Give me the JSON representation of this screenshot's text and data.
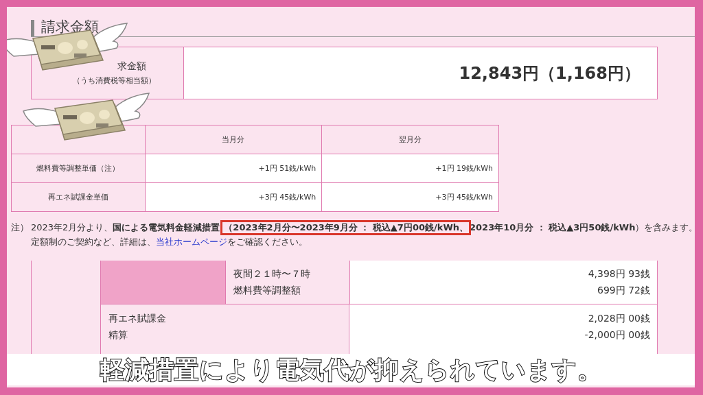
{
  "section_title": "請求金額",
  "bill": {
    "label": "求金額",
    "sublabel": "（うち消費税等相当額）",
    "amount": "12,843円（1,168円）"
  },
  "rates": {
    "columns": [
      "当月分",
      "翌月分"
    ],
    "rows": [
      {
        "label": "燃料費等調整単価（注）",
        "values": [
          "+1円 51銭/kWh",
          "+1円 19銭/kWh"
        ]
      },
      {
        "label": "再エネ賦課金単価",
        "values": [
          "+3円 45銭/kWh",
          "+3円 45銭/kWh"
        ]
      }
    ]
  },
  "note": {
    "mark": "注）",
    "segments": [
      {
        "text": "2023年2月分より、**国による電気料金軽減措置**",
        "highlighted": false
      },
      {
        "text": "**（2023年2月分〜2023年9月分 ： 税込▲7円00銭/kWh、**",
        "highlighted": true
      },
      {
        "text": "**2023年10月分 ： 税込▲3円50銭/kWh**）を含みます。",
        "highlighted": false
      }
    ],
    "line2_before": "定額制のご契約など、詳細は、",
    "link": "当社ホームページ",
    "line2_after": "をご確認ください。"
  },
  "charges": [
    {
      "kind": "shaded",
      "labels": [
        "夜間２１時〜７時",
        "燃料費等調整額"
      ],
      "values": [
        "4,398円 93銭",
        "699円 72銭"
      ]
    },
    {
      "kind": "plain",
      "labels": [
        "再エネ賦課金",
        "精算"
      ],
      "values": [
        "2,028円 00銭",
        "-2,000円 00銭"
      ]
    }
  ],
  "subtitle": "軽減措置により電気代が抑えられています。"
}
